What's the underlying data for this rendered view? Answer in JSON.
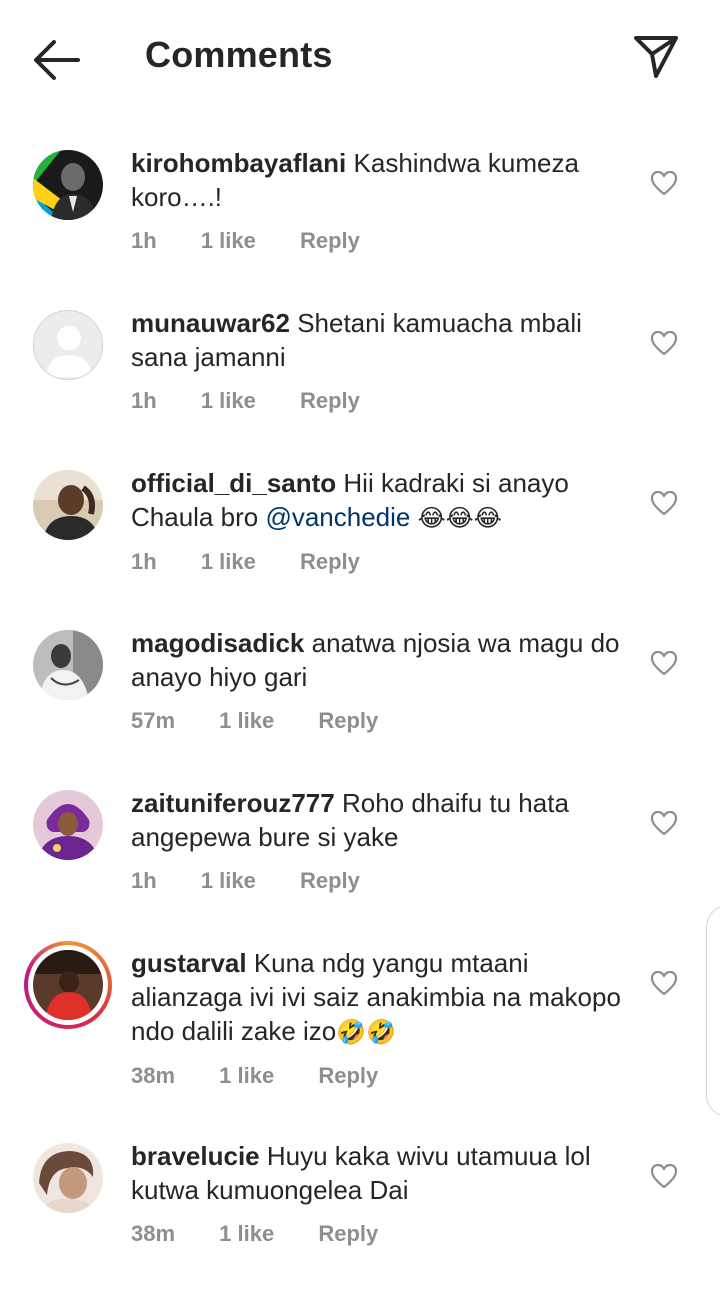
{
  "header": {
    "title": "Comments",
    "back_icon": "arrow-left-icon",
    "share_icon": "paper-plane-icon"
  },
  "comments": [
    {
      "username": "kirohombayaflani",
      "text": "Kashindwa kumeza koro….!",
      "time": "1h",
      "likes": "1 like",
      "reply": "Reply",
      "avatar": "portrait-flag-avatar"
    },
    {
      "username": "munauwar62",
      "text": "Shetani kamuacha mbali sana jamanni",
      "time": "1h",
      "likes": "1 like",
      "reply": "Reply",
      "avatar": "default-avatar"
    },
    {
      "username": "official_di_santo",
      "text": "Hii kadraki si anayo Chaula bro",
      "mention": "@vanchedie",
      "emoji": "😂😂😂",
      "time": "1h",
      "likes": "1 like",
      "reply": "Reply",
      "avatar": "photo-avatar"
    },
    {
      "username": "magodisadick",
      "text": "anatwa njosia wa magu do anayo hiyo gari",
      "time": "57m",
      "likes": "1 like",
      "reply": "Reply",
      "avatar": "bw-photo-avatar"
    },
    {
      "username": "zaituniferouz777",
      "text": "Roho dhaifu tu hata angepewa bure si yake",
      "time": "1h",
      "likes": "1 like",
      "reply": "Reply",
      "avatar": "purple-photo-avatar"
    },
    {
      "username": "gustarval",
      "text": "Kuna ndg yangu mtaani alianzaga ivi ivi saiz anakimbia na makopo ndo dalili zake izo",
      "emoji": "🤣🤣",
      "time": "38m",
      "likes": "1 like",
      "reply": "Reply",
      "avatar": "story-ring-avatar"
    },
    {
      "username": "bravelucie",
      "text": "Huyu kaka wivu utamuua lol kutwa kumuongelea Dai",
      "time": "38m",
      "likes": "1 like",
      "reply": "Reply",
      "avatar": "photo-avatar"
    }
  ],
  "icons": {
    "like": "heart-outline-icon"
  }
}
